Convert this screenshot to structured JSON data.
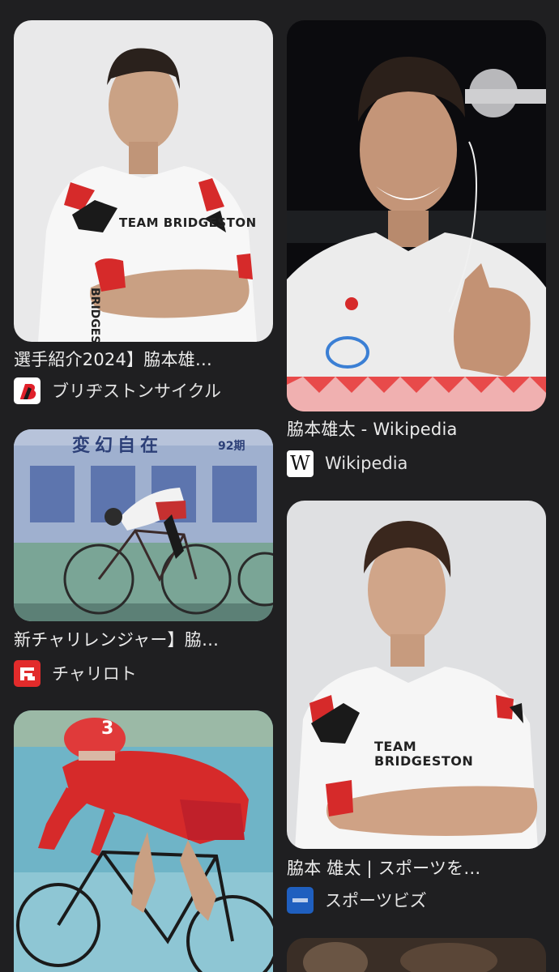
{
  "results": {
    "left": [
      {
        "title": "選手紹介2024】脇本雄…",
        "source": "ブリヂストンサイクル",
        "favicon": "bridgestone-logo-icon",
        "jersey_text": "TEAM BRIDGESTON"
      },
      {
        "title": "新チャリレンジャー】脇…",
        "source": "チャリロト",
        "favicon": "chariloto-logo-icon",
        "banner_text": "変幻自在",
        "banner_sub": "92期"
      },
      {
        "title": "",
        "source": "",
        "favicon": "",
        "helmet_number": "3"
      }
    ],
    "right": [
      {
        "title": "脇本雄太 - Wikipedia",
        "source": "Wikipedia",
        "favicon": "wikipedia-logo-icon"
      },
      {
        "title": "脇本 雄太 | スポーツを…",
        "source": "スポーツビズ",
        "favicon": "sportsbiz-logo-icon",
        "jersey_text": "TEAM BRIDGESTON"
      }
    ]
  },
  "colors": {
    "background": "#1f1f21",
    "text": "#ececec",
    "jersey_red": "#d62a2a",
    "bridgestone_red": "#e0202a",
    "sportsbiz_blue": "#1f5fbf"
  }
}
